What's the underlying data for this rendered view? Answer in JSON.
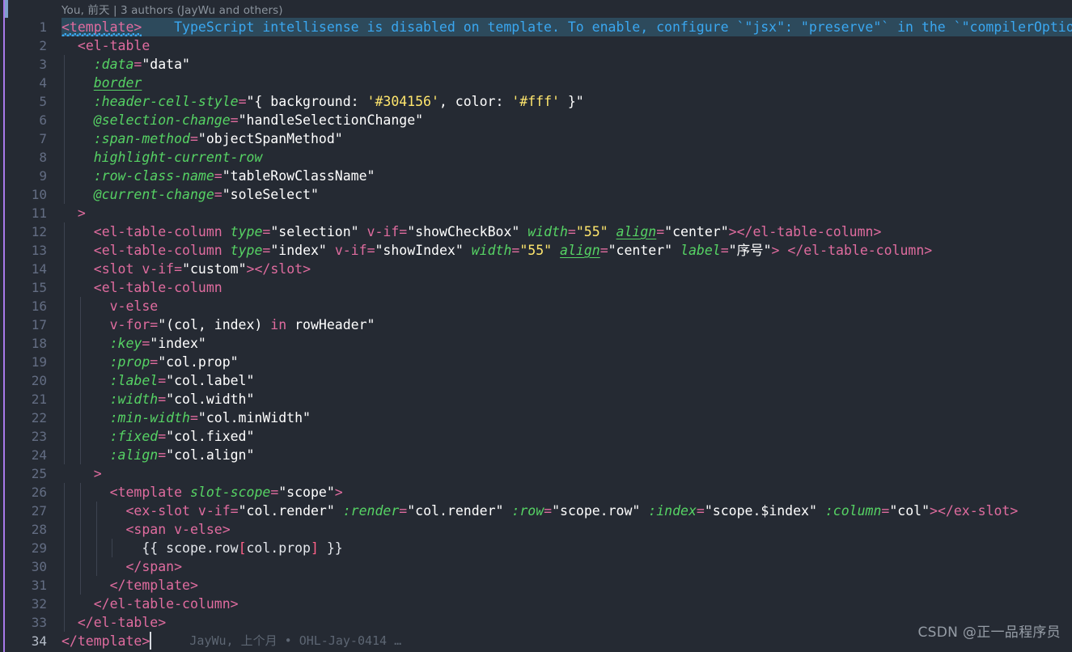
{
  "editor": {
    "language": "vue-html",
    "background": "#252a33",
    "gutter_color": "#636d83",
    "accent_purple": "#a779e9",
    "hint_color": "#3aa7f0",
    "selection_color": "#2d4a5c"
  },
  "codelens": {
    "text": "You, 前天 | 3 authors (JayWu and others)"
  },
  "inline_hint": {
    "text": "TypeScript intellisense is disabled on template. To enable, configure `\"jsx\": \"preserve\"` in the `\"compilerOptions\"` pr"
  },
  "blame_inline": {
    "text": "JayWu, 上个月 • OHL-Jay-0414 …"
  },
  "watermark": {
    "text": "CSDN @正一品程序员"
  },
  "lines": [
    {
      "n": "1",
      "text": "<template>"
    },
    {
      "n": "2",
      "text": "  <el-table"
    },
    {
      "n": "3",
      "text": "    :data=\"data\""
    },
    {
      "n": "4",
      "text": "    border"
    },
    {
      "n": "5",
      "text": "    :header-cell-style=\"{ background: '#304156', color: '#fff' }\""
    },
    {
      "n": "6",
      "text": "    @selection-change=\"handleSelectionChange\""
    },
    {
      "n": "7",
      "text": "    :span-method=\"objectSpanMethod\""
    },
    {
      "n": "8",
      "text": "    highlight-current-row"
    },
    {
      "n": "9",
      "text": "    :row-class-name=\"tableRowClassName\""
    },
    {
      "n": "10",
      "text": "    @current-change=\"soleSelect\""
    },
    {
      "n": "11",
      "text": "  >"
    },
    {
      "n": "12",
      "text": "    <el-table-column type=\"selection\" v-if=\"showCheckBox\" width=\"55\" align=\"center\"></el-table-column>"
    },
    {
      "n": "13",
      "text": "    <el-table-column type=\"index\" v-if=\"showIndex\" width=\"55\" align=\"center\" label=\"序号\"> </el-table-column>"
    },
    {
      "n": "14",
      "text": "    <slot v-if=\"custom\"></slot>"
    },
    {
      "n": "15",
      "text": "    <el-table-column"
    },
    {
      "n": "16",
      "text": "      v-else"
    },
    {
      "n": "17",
      "text": "      v-for=\"(col, index) in rowHeader\""
    },
    {
      "n": "18",
      "text": "      :key=\"index\""
    },
    {
      "n": "19",
      "text": "      :prop=\"col.prop\""
    },
    {
      "n": "20",
      "text": "      :label=\"col.label\""
    },
    {
      "n": "21",
      "text": "      :width=\"col.width\""
    },
    {
      "n": "22",
      "text": "      :min-width=\"col.minWidth\""
    },
    {
      "n": "23",
      "text": "      :fixed=\"col.fixed\""
    },
    {
      "n": "24",
      "text": "      :align=\"col.align\""
    },
    {
      "n": "25",
      "text": "    >"
    },
    {
      "n": "26",
      "text": "      <template slot-scope=\"scope\">"
    },
    {
      "n": "27",
      "text": "        <ex-slot v-if=\"col.render\" :render=\"col.render\" :row=\"scope.row\" :index=\"scope.$index\" :column=\"col\"></ex-slot>"
    },
    {
      "n": "28",
      "text": "        <span v-else>"
    },
    {
      "n": "29",
      "text": "          {{ scope.row[col.prop] }}"
    },
    {
      "n": "30",
      "text": "        </span>"
    },
    {
      "n": "31",
      "text": "      </template>"
    },
    {
      "n": "32",
      "text": "    </el-table-column>"
    },
    {
      "n": "33",
      "text": "  </el-table>"
    },
    {
      "n": "34",
      "text": "</template>"
    }
  ],
  "tokens": {
    "1": [
      [
        "<template>",
        "t-tag"
      ]
    ],
    "2": [
      [
        "  ",
        "t-plain"
      ],
      [
        "<",
        "t-tag"
      ],
      [
        "el-table",
        "t-tag"
      ]
    ],
    "3": [
      [
        "    ",
        "t-plain"
      ],
      [
        ":data",
        "t-attr"
      ],
      [
        "=",
        "t-punc"
      ],
      [
        "\"data\"",
        "t-str"
      ]
    ],
    "4": [
      [
        "    ",
        "t-plain"
      ],
      [
        "border",
        "t-attr t-underline"
      ]
    ],
    "5": [
      [
        "    ",
        "t-plain"
      ],
      [
        ":header-cell-style",
        "t-attr"
      ],
      [
        "=",
        "t-punc"
      ],
      [
        "\"{ background: ",
        "t-str"
      ],
      [
        "'#304156'",
        "t-num"
      ],
      [
        ", color: ",
        "t-str"
      ],
      [
        "'#fff'",
        "t-num"
      ],
      [
        " }\"",
        "t-str"
      ]
    ],
    "6": [
      [
        "    ",
        "t-plain"
      ],
      [
        "@selection-change",
        "t-attr"
      ],
      [
        "=",
        "t-punc"
      ],
      [
        "\"handleSelectionChange\"",
        "t-str"
      ]
    ],
    "7": [
      [
        "    ",
        "t-plain"
      ],
      [
        ":span-method",
        "t-attr"
      ],
      [
        "=",
        "t-punc"
      ],
      [
        "\"objectSpanMethod\"",
        "t-str"
      ]
    ],
    "8": [
      [
        "    ",
        "t-plain"
      ],
      [
        "highlight-current-row",
        "t-attr"
      ]
    ],
    "9": [
      [
        "    ",
        "t-plain"
      ],
      [
        ":row-class-name",
        "t-attr"
      ],
      [
        "=",
        "t-punc"
      ],
      [
        "\"tableRowClassName\"",
        "t-str"
      ]
    ],
    "10": [
      [
        "    ",
        "t-plain"
      ],
      [
        "@current-change",
        "t-attr"
      ],
      [
        "=",
        "t-punc"
      ],
      [
        "\"soleSelect\"",
        "t-str"
      ]
    ],
    "11": [
      [
        "  ",
        "t-plain"
      ],
      [
        ">",
        "t-tag"
      ]
    ],
    "12": [
      [
        "    ",
        "t-plain"
      ],
      [
        "<",
        "t-tag"
      ],
      [
        "el-table-column",
        "t-tag"
      ],
      [
        " ",
        "t-plain"
      ],
      [
        "type",
        "t-attr"
      ],
      [
        "=",
        "t-punc"
      ],
      [
        "\"selection\"",
        "t-str"
      ],
      [
        " ",
        "t-plain"
      ],
      [
        "v-if",
        "t-dir"
      ],
      [
        "=",
        "t-punc"
      ],
      [
        "\"showCheckBox\"",
        "t-str"
      ],
      [
        " ",
        "t-plain"
      ],
      [
        "width",
        "t-attr"
      ],
      [
        "=",
        "t-punc"
      ],
      [
        "\"55\"",
        "t-num"
      ],
      [
        " ",
        "t-plain"
      ],
      [
        "align",
        "t-attr t-underline"
      ],
      [
        "=",
        "t-punc"
      ],
      [
        "\"center\"",
        "t-str"
      ],
      [
        ">",
        "t-tag"
      ],
      [
        "</",
        "t-tag"
      ],
      [
        "el-table-column",
        "t-tag"
      ],
      [
        ">",
        "t-tag"
      ]
    ],
    "13": [
      [
        "    ",
        "t-plain"
      ],
      [
        "<",
        "t-tag"
      ],
      [
        "el-table-column",
        "t-tag"
      ],
      [
        " ",
        "t-plain"
      ],
      [
        "type",
        "t-attr"
      ],
      [
        "=",
        "t-punc"
      ],
      [
        "\"index\"",
        "t-str"
      ],
      [
        " ",
        "t-plain"
      ],
      [
        "v-if",
        "t-dir"
      ],
      [
        "=",
        "t-punc"
      ],
      [
        "\"showIndex\"",
        "t-str"
      ],
      [
        " ",
        "t-plain"
      ],
      [
        "width",
        "t-attr"
      ],
      [
        "=",
        "t-punc"
      ],
      [
        "\"55\"",
        "t-num"
      ],
      [
        " ",
        "t-plain"
      ],
      [
        "align",
        "t-attr t-underline"
      ],
      [
        "=",
        "t-punc"
      ],
      [
        "\"center\"",
        "t-str"
      ],
      [
        " ",
        "t-plain"
      ],
      [
        "label",
        "t-attr"
      ],
      [
        "=",
        "t-punc"
      ],
      [
        "\"序号\"",
        "t-str"
      ],
      [
        "> ",
        "t-tag"
      ],
      [
        "</",
        "t-tag"
      ],
      [
        "el-table-column",
        "t-tag"
      ],
      [
        ">",
        "t-tag"
      ]
    ],
    "14": [
      [
        "    ",
        "t-plain"
      ],
      [
        "<",
        "t-tag"
      ],
      [
        "slot",
        "t-tag"
      ],
      [
        " ",
        "t-plain"
      ],
      [
        "v-if",
        "t-dir"
      ],
      [
        "=",
        "t-punc"
      ],
      [
        "\"custom\"",
        "t-str"
      ],
      [
        ">",
        "t-tag"
      ],
      [
        "</",
        "t-tag"
      ],
      [
        "slot",
        "t-tag"
      ],
      [
        ">",
        "t-tag"
      ]
    ],
    "15": [
      [
        "    ",
        "t-plain"
      ],
      [
        "<",
        "t-tag"
      ],
      [
        "el-table-column",
        "t-tag"
      ]
    ],
    "16": [
      [
        "      ",
        "t-plain"
      ],
      [
        "v-else",
        "t-dir"
      ]
    ],
    "17": [
      [
        "      ",
        "t-plain"
      ],
      [
        "v-for",
        "t-dir"
      ],
      [
        "=",
        "t-punc"
      ],
      [
        "\"(col, index) ",
        "t-str"
      ],
      [
        "in",
        "t-kw"
      ],
      [
        " rowHeader\"",
        "t-str"
      ]
    ],
    "18": [
      [
        "      ",
        "t-plain"
      ],
      [
        ":key",
        "t-attr"
      ],
      [
        "=",
        "t-punc"
      ],
      [
        "\"index\"",
        "t-str"
      ]
    ],
    "19": [
      [
        "      ",
        "t-plain"
      ],
      [
        ":prop",
        "t-attr"
      ],
      [
        "=",
        "t-punc"
      ],
      [
        "\"col.prop\"",
        "t-str"
      ]
    ],
    "20": [
      [
        "      ",
        "t-plain"
      ],
      [
        ":label",
        "t-attr"
      ],
      [
        "=",
        "t-punc"
      ],
      [
        "\"col.label\"",
        "t-str"
      ]
    ],
    "21": [
      [
        "      ",
        "t-plain"
      ],
      [
        ":width",
        "t-attr"
      ],
      [
        "=",
        "t-punc"
      ],
      [
        "\"col.width\"",
        "t-str"
      ]
    ],
    "22": [
      [
        "      ",
        "t-plain"
      ],
      [
        ":min-width",
        "t-attr"
      ],
      [
        "=",
        "t-punc"
      ],
      [
        "\"col.minWidth\"",
        "t-str"
      ]
    ],
    "23": [
      [
        "      ",
        "t-plain"
      ],
      [
        ":fixed",
        "t-attr"
      ],
      [
        "=",
        "t-punc"
      ],
      [
        "\"col.fixed\"",
        "t-str"
      ]
    ],
    "24": [
      [
        "      ",
        "t-plain"
      ],
      [
        ":align",
        "t-attr"
      ],
      [
        "=",
        "t-punc"
      ],
      [
        "\"col.align\"",
        "t-str"
      ]
    ],
    "25": [
      [
        "    ",
        "t-plain"
      ],
      [
        ">",
        "t-tag"
      ]
    ],
    "26": [
      [
        "      ",
        "t-plain"
      ],
      [
        "<",
        "t-tag"
      ],
      [
        "template",
        "t-tag"
      ],
      [
        " ",
        "t-plain"
      ],
      [
        "slot-scope",
        "t-attr"
      ],
      [
        "=",
        "t-punc"
      ],
      [
        "\"scope\"",
        "t-str"
      ],
      [
        ">",
        "t-tag"
      ]
    ],
    "27": [
      [
        "        ",
        "t-plain"
      ],
      [
        "<",
        "t-tag"
      ],
      [
        "ex-slot",
        "t-tag"
      ],
      [
        " ",
        "t-plain"
      ],
      [
        "v-if",
        "t-dir"
      ],
      [
        "=",
        "t-punc"
      ],
      [
        "\"col.render\"",
        "t-str"
      ],
      [
        " ",
        "t-plain"
      ],
      [
        ":render",
        "t-attr"
      ],
      [
        "=",
        "t-punc"
      ],
      [
        "\"col.render\"",
        "t-str"
      ],
      [
        " ",
        "t-plain"
      ],
      [
        ":row",
        "t-attr"
      ],
      [
        "=",
        "t-punc"
      ],
      [
        "\"scope.row\"",
        "t-str"
      ],
      [
        " ",
        "t-plain"
      ],
      [
        ":index",
        "t-attr"
      ],
      [
        "=",
        "t-punc"
      ],
      [
        "\"scope.$index\"",
        "t-str"
      ],
      [
        " ",
        "t-plain"
      ],
      [
        ":column",
        "t-attr"
      ],
      [
        "=",
        "t-punc"
      ],
      [
        "\"col\"",
        "t-str"
      ],
      [
        ">",
        "t-tag"
      ],
      [
        "</",
        "t-tag"
      ],
      [
        "ex-slot",
        "t-tag"
      ],
      [
        ">",
        "t-tag"
      ]
    ],
    "28": [
      [
        "        ",
        "t-plain"
      ],
      [
        "<",
        "t-tag"
      ],
      [
        "span",
        "t-tag"
      ],
      [
        " ",
        "t-plain"
      ],
      [
        "v-else",
        "t-dir"
      ],
      [
        ">",
        "t-tag"
      ]
    ],
    "29": [
      [
        "          ",
        "t-plain"
      ],
      [
        "{{ scope.row",
        "t-moustache"
      ],
      [
        "[",
        "t-brk"
      ],
      [
        "col.prop",
        "t-moustache"
      ],
      [
        "]",
        "t-brk"
      ],
      [
        " }}",
        "t-moustache"
      ]
    ],
    "30": [
      [
        "        ",
        "t-plain"
      ],
      [
        "</",
        "t-tag"
      ],
      [
        "span",
        "t-tag"
      ],
      [
        ">",
        "t-tag"
      ]
    ],
    "31": [
      [
        "      ",
        "t-plain"
      ],
      [
        "</",
        "t-tag"
      ],
      [
        "template",
        "t-tag"
      ],
      [
        ">",
        "t-tag"
      ]
    ],
    "32": [
      [
        "    ",
        "t-plain"
      ],
      [
        "</",
        "t-tag"
      ],
      [
        "el-table-column",
        "t-tag"
      ],
      [
        ">",
        "t-tag"
      ]
    ],
    "33": [
      [
        "  ",
        "t-plain"
      ],
      [
        "</",
        "t-tag"
      ],
      [
        "el-table",
        "t-tag"
      ],
      [
        ">",
        "t-tag"
      ]
    ],
    "34": [
      [
        "</",
        "t-tag"
      ],
      [
        "template",
        "t-tag"
      ],
      [
        ">",
        "t-tag"
      ]
    ]
  },
  "indent_guides": {
    "3": [
      1
    ],
    "4": [
      1
    ],
    "5": [
      1
    ],
    "6": [
      1
    ],
    "7": [
      1
    ],
    "8": [
      1
    ],
    "9": [
      1
    ],
    "10": [
      1
    ],
    "12": [
      1
    ],
    "13": [
      1
    ],
    "14": [
      1
    ],
    "15": [
      1
    ],
    "16": [
      1,
      2
    ],
    "17": [
      1,
      2
    ],
    "18": [
      1,
      2
    ],
    "19": [
      1,
      2
    ],
    "20": [
      1,
      2
    ],
    "21": [
      1,
      2
    ],
    "22": [
      1,
      2
    ],
    "23": [
      1,
      2
    ],
    "24": [
      1,
      2
    ],
    "26": [
      1,
      2
    ],
    "27": [
      1,
      2,
      3
    ],
    "28": [
      1,
      2,
      3
    ],
    "29": [
      1,
      2,
      3,
      4
    ],
    "30": [
      1,
      2,
      3
    ],
    "31": [
      1,
      2
    ],
    "32": [
      1
    ],
    "33": [
      1
    ]
  }
}
